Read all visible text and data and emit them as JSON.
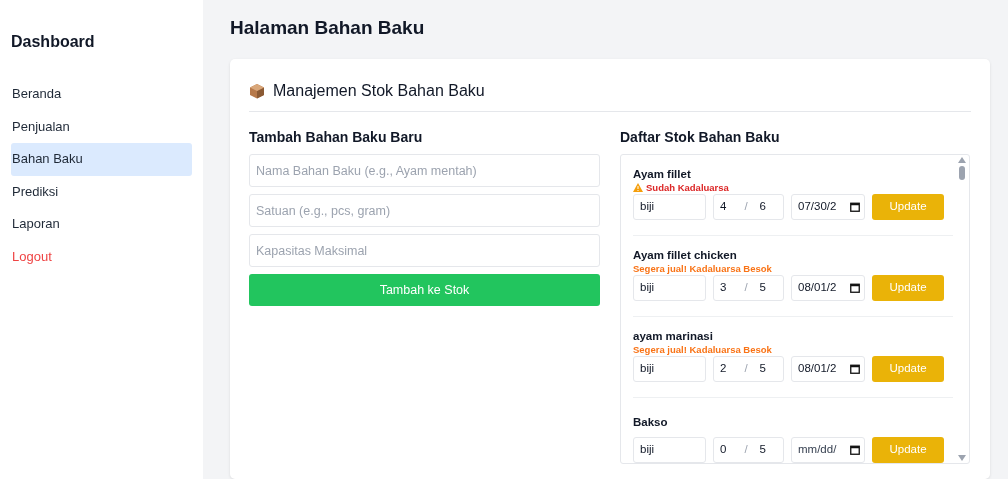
{
  "sidebar": {
    "title": "Dashboard",
    "items": [
      {
        "label": "Beranda",
        "selected": false,
        "kind": "link"
      },
      {
        "label": "Penjualan",
        "selected": false,
        "kind": "link"
      },
      {
        "label": "Bahan Baku",
        "selected": true,
        "kind": "link"
      },
      {
        "label": "Prediksi",
        "selected": false,
        "kind": "link"
      },
      {
        "label": "Laporan",
        "selected": false,
        "kind": "link"
      },
      {
        "label": "Logout",
        "selected": false,
        "kind": "logout"
      }
    ]
  },
  "page_title": "Halaman Bahan Baku",
  "card": {
    "title": "Manajemen Stok Bahan Baku"
  },
  "add_form": {
    "heading": "Tambah Bahan Baku Baru",
    "fields": [
      {
        "placeholder": "Nama Bahan Baku (e.g., Ayam mentah)"
      },
      {
        "placeholder": "Satuan (e.g., pcs, gram)"
      },
      {
        "placeholder": "Kapasitas Maksimal"
      }
    ],
    "submit": "Tambah ke Stok"
  },
  "stock_list": {
    "heading": "Daftar Stok Bahan Baku",
    "items": [
      {
        "name": "Ayam fillet",
        "kind": "expired",
        "status_text": "Sudah Kadaluarsa",
        "unit": "biji",
        "quantity": "4",
        "separator": "/",
        "max": "6",
        "date": "07/30/2",
        "button": "Update"
      },
      {
        "name": "Ayam fillet chicken",
        "kind": "soon",
        "status_text": "Segera jual! Kadaluarsa Besok",
        "unit": "biji",
        "quantity": "3",
        "separator": "/",
        "max": "5",
        "date": "08/01/2",
        "button": "Update"
      },
      {
        "name": "ayam marinasi",
        "kind": "soon",
        "status_text": "Segera jual! Kadaluarsa Besok",
        "unit": "biji",
        "quantity": "2",
        "separator": "/",
        "max": "5",
        "date": "08/01/2",
        "button": "Update"
      },
      {
        "name": "Bakso",
        "kind": "plain",
        "unit": "biji",
        "quantity": "0",
        "separator": "/",
        "max": "5",
        "date_placeholder": "mm/dd/",
        "button": "Update"
      }
    ]
  }
}
